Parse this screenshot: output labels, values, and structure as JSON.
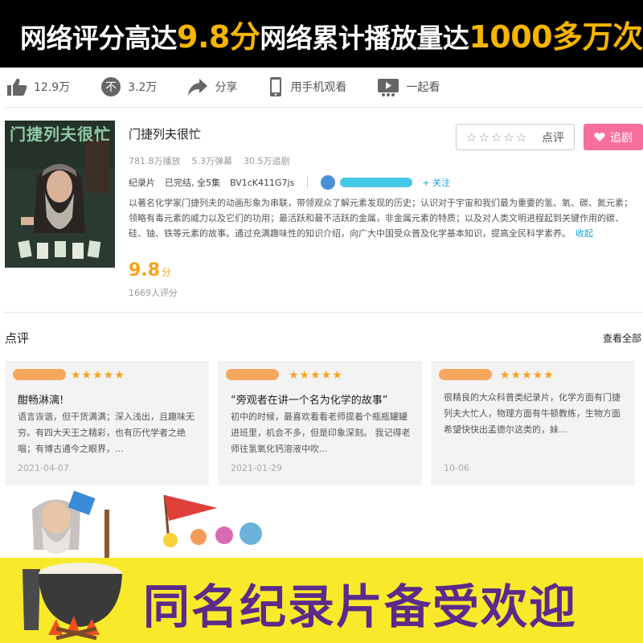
{
  "top_banner": {
    "left_prefix": "网络评分高达",
    "left_highlight": "9.8分",
    "right_prefix": "网络累计播放量达",
    "right_highlight": "1000多万次"
  },
  "actions": [
    {
      "icon": "thumbs-up-icon",
      "label": "12.9万"
    },
    {
      "icon": "thumbs-down-icon",
      "label": "3.2万"
    },
    {
      "icon": "share-icon",
      "label": "分享"
    },
    {
      "icon": "phone-icon",
      "label": "用手机观看"
    },
    {
      "icon": "watch-together-icon",
      "label": "一起看"
    }
  ],
  "show": {
    "poster_title": "门捷列夫很忙",
    "title": "门捷列夫很忙",
    "plays": "781.8万播放",
    "danmaku": "5.3万弹幕",
    "followers": "30.5万追剧",
    "category": "纪录片",
    "status": "已完结, 全5集",
    "bvid": "BV1cK411G7js",
    "follow_uploader": "+ 关注",
    "description": "以著名化学家门捷列夫的动画形象为串联，带领观众了解元素发现的历史；认识对于宇宙和我们最为重要的氢、氧、碳、氮元素；领略有毒元素的威力以及它们的功用；最活跃和最不活跃的金属，非金属元素的特质；以及对人类文明进程起到关键作用的碳、硅、铀、铁等元素的故事。通过充满趣味性的知识介绍，向广大中国受众普及化学基本知识，提高全民科学素养。",
    "collapse_label": "收起",
    "score": "9.8",
    "score_unit": "分",
    "raters": "1669人评分",
    "rate_label": "点评",
    "rate_stars": "☆☆☆☆☆",
    "follow_label": "追剧"
  },
  "reviews": {
    "title": "点评",
    "see_all": "查看全部",
    "stars": "★★★★★",
    "items": [
      {
        "title": "酣畅淋漓!",
        "body": "语言诙谐，但干货满满；深入浅出，且趣味无穷。有四大天王之精彩，也有历代学者之绝唱；有博古通今之眼界，...",
        "date": "2021-04-07"
      },
      {
        "title": "“旁观者在讲一个名为化学的故事”",
        "body": "初中的时候，最喜欢看看老师提着个瓶瓶罐罐进班里，机会不多，但是印象深刻。 我记得老师往氢氧化钙溶液中吹...",
        "date": "2021-01-29"
      },
      {
        "title": "",
        "body": "很精良的大众科普类纪录片，化学方面有门捷列夫大忙人，物理方面有牛顿教练，生物方面希望快快出孟德尔这类的，妹...",
        "date": "10-06"
      }
    ]
  },
  "bottom_banner": {
    "text": "同名纪录片备受欢迎"
  }
}
